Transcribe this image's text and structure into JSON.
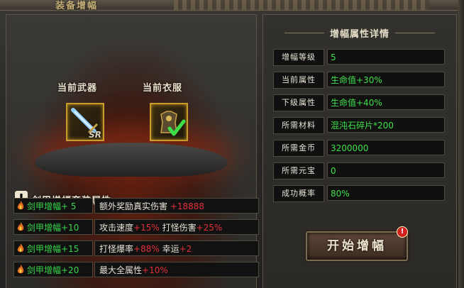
{
  "window": {
    "title": "装备增幅"
  },
  "slots": {
    "weapon": {
      "label": "当前武器",
      "badge": "SR",
      "icon": "sword-icon"
    },
    "armor": {
      "label": "当前衣服",
      "icon": "armor-icon",
      "status_icon": "checkmark-icon"
    }
  },
  "set_bonus": {
    "title": "剑甲增幅套装属性",
    "rows": [
      {
        "name": "剑甲增幅+ 5",
        "parts": [
          {
            "t": "额外奖励真实伤害 ",
            "c": "w"
          },
          {
            "t": "+18888",
            "c": "r"
          }
        ]
      },
      {
        "name": "剑甲增幅+10",
        "parts": [
          {
            "t": "攻击速度",
            "c": "w"
          },
          {
            "t": "+15%",
            "c": "r"
          },
          {
            "t": "  打怪伤害",
            "c": "w"
          },
          {
            "t": "+25%",
            "c": "r"
          }
        ]
      },
      {
        "name": "剑甲增幅+15",
        "parts": [
          {
            "t": "打怪爆率",
            "c": "w"
          },
          {
            "t": "+88%",
            "c": "r"
          },
          {
            "t": "  幸运",
            "c": "w"
          },
          {
            "t": "+2",
            "c": "r"
          }
        ]
      },
      {
        "name": "剑甲增幅+20",
        "parts": [
          {
            "t": "最大全属性",
            "c": "w"
          },
          {
            "t": "+10%",
            "c": "r"
          }
        ]
      }
    ]
  },
  "details": {
    "title": "增幅属性详情",
    "rows": [
      {
        "key": "增幅等级",
        "value": "5"
      },
      {
        "key": "当前属性",
        "value": "生命值+30%"
      },
      {
        "key": "下级属性",
        "value": "生命值+40%"
      },
      {
        "key": "所需材料",
        "value": "混沌石碎片*200"
      },
      {
        "key": "所需金币",
        "value": "3200000"
      },
      {
        "key": "所需元宝",
        "value": "0"
      },
      {
        "key": "成功概率",
        "value": "80%"
      }
    ]
  },
  "start_button": {
    "label": "开始增幅",
    "alert": "!"
  },
  "colors": {
    "green": "#3ee04a",
    "red": "#e0303a",
    "gold": "#c99b2a"
  }
}
